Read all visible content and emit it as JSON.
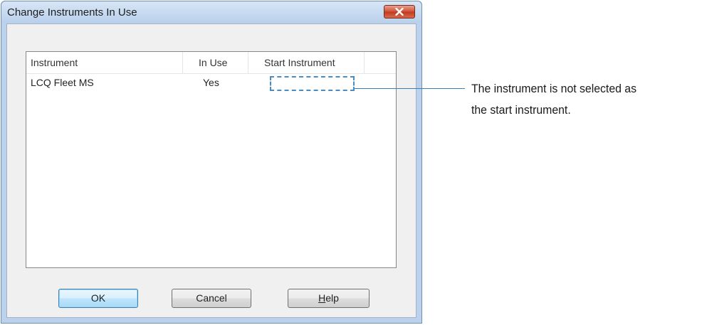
{
  "dialog": {
    "title": "Change Instruments In Use",
    "close_icon": "close-icon"
  },
  "list": {
    "columns": [
      "Instrument",
      "In Use",
      "Start Instrument"
    ],
    "rows": [
      {
        "instrument": "LCQ Fleet MS",
        "in_use": "Yes",
        "start_instrument": ""
      }
    ]
  },
  "buttons": {
    "ok": "OK",
    "cancel": "Cancel",
    "help_accel": "H",
    "help_rest": "elp"
  },
  "callout": {
    "line1": "The instrument is not selected as",
    "line2": "the start instrument."
  },
  "colors": {
    "callout_accent": "#4a8dc4",
    "close_button": "#c0391f"
  }
}
